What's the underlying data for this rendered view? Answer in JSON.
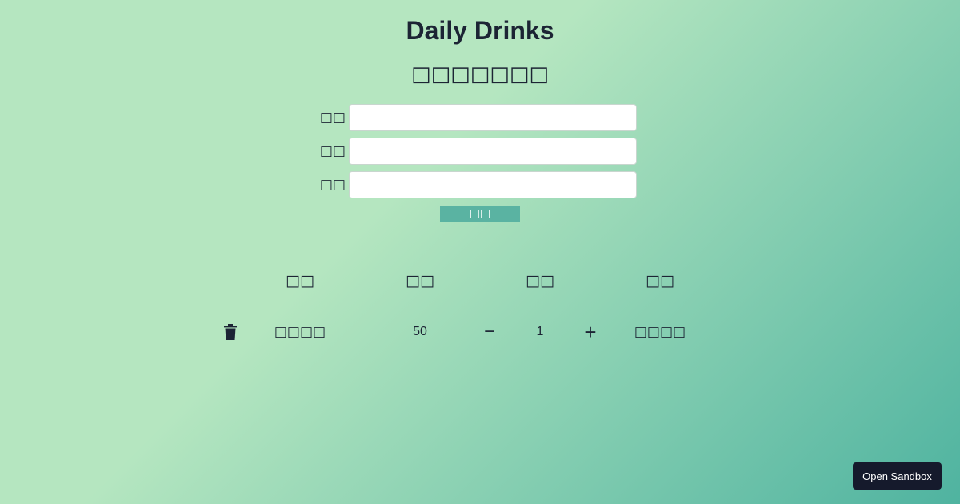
{
  "header": {
    "title": "Daily Drinks",
    "subtitle": "□□□□□□□"
  },
  "form": {
    "fields": [
      {
        "label": "□□",
        "value": "",
        "placeholder": ""
      },
      {
        "label": "□□",
        "value": "",
        "placeholder": ""
      },
      {
        "label": "□□",
        "value": "",
        "placeholder": ""
      }
    ],
    "submit_label": "□□"
  },
  "table": {
    "columns": [
      "□□",
      "□□",
      "□□",
      "□□"
    ],
    "rows": [
      {
        "name": "□□□□",
        "price": "50",
        "quantity": "1",
        "subtotal": "□□□□"
      }
    ],
    "delete_icon": "trash-icon",
    "decrement_symbol": "−",
    "increment_symbol": "+"
  },
  "footer": {
    "sandbox_label": "Open Sandbox"
  },
  "colors": {
    "gradient_start": "#b5e6c0",
    "gradient_end": "#4fb3a0",
    "text": "#1c2434",
    "submit_bg": "#5ab3a2",
    "sandbox_bg": "#151a2c"
  }
}
